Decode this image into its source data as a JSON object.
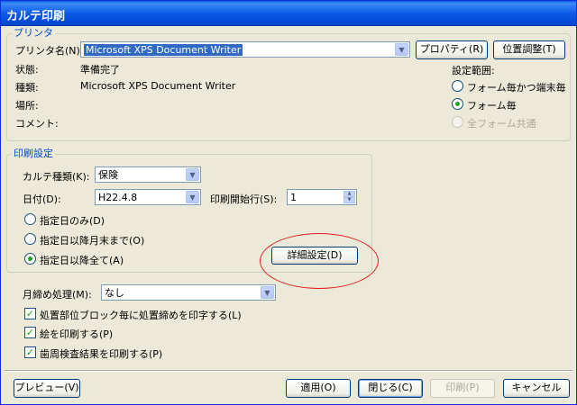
{
  "window": {
    "title": "カルテ印刷"
  },
  "printer": {
    "group_title": "プリンタ",
    "name_label": "プリンタ名(N) :",
    "name_value": "Microsoft XPS Document Writer",
    "properties_button": "プロパティ(R)",
    "position_button": "位置調整(T)",
    "status_label": "状態:",
    "status_value": "準備完了",
    "type_label": "種類:",
    "type_value": "Microsoft XPS Document Writer",
    "location_label": "場所:",
    "comment_label": "コメント:",
    "range_label": "設定範囲:",
    "range_options": [
      "フォーム毎かつ端末毎",
      "フォーム毎",
      "全フォーム共通"
    ]
  },
  "print_settings": {
    "group_title": "印刷設定",
    "karte_type_label": "カルテ種類(K):",
    "karte_type_value": "保険",
    "date_label": "日付(D):",
    "date_value": "H22.4.8",
    "start_line_label": "印刷開始行(S):",
    "start_line_value": "1",
    "date_options": [
      "指定日のみ(D)",
      "指定日以降月末まで(O)",
      "指定日以降全て(A)"
    ],
    "detail_button": "詳細設定(D)"
  },
  "monthly": {
    "label": "月締め処理(M):",
    "value": "なし"
  },
  "checkboxes": [
    "処置部位ブロック毎に処置締めを印字する(L)",
    "絵を印刷する(P)",
    "歯周検査結果を印刷する(P)"
  ],
  "footer": {
    "preview": "プレビュー(V)",
    "apply": "適用(O)",
    "close": "閉じる(C)",
    "print": "印刷(P)",
    "cancel": "キャンセル"
  }
}
